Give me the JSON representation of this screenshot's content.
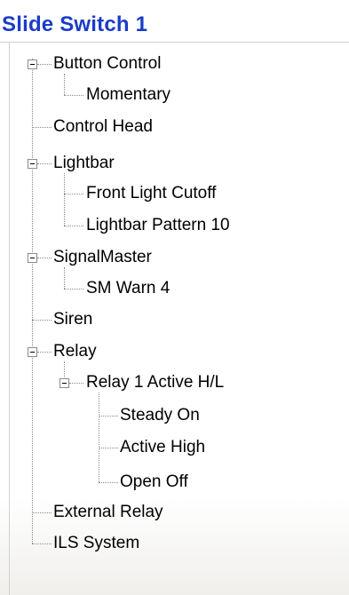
{
  "title": "Slide Switch 1",
  "tree": {
    "button_control": "Button Control",
    "momentary": "Momentary",
    "control_head": "Control Head",
    "lightbar": "Lightbar",
    "front_light_cutoff": "Front Light Cutoff",
    "lightbar_pattern_10": "Lightbar Pattern 10",
    "signalmaster": "SignalMaster",
    "sm_warn_4": "SM Warn 4",
    "siren": "Siren",
    "relay": "Relay",
    "relay_1_active": "Relay 1 Active H/L",
    "steady_on": "Steady On",
    "active_high": "Active High",
    "open_off": "Open Off",
    "external_relay": "External Relay",
    "ils_system": "ILS System"
  },
  "colors": {
    "title": "#1a3cc8",
    "tree_lines": "#8a8a8a"
  }
}
